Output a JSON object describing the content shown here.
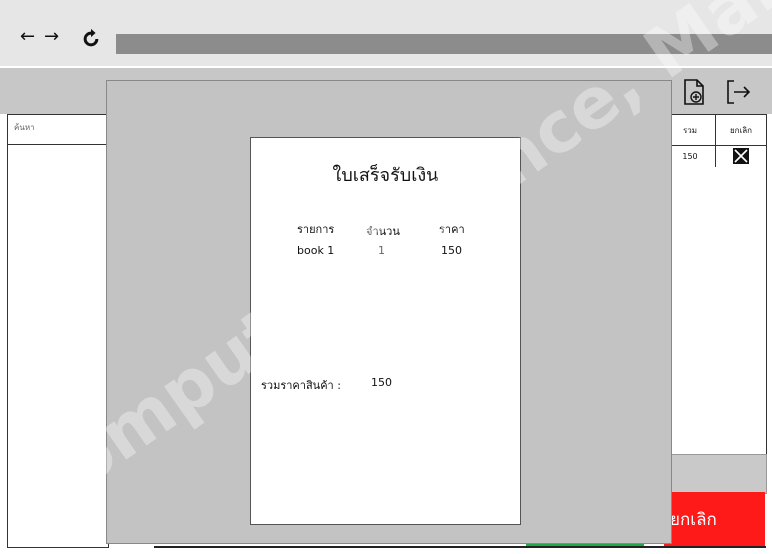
{
  "browser": {
    "back_icon": "arrow-left-icon",
    "forward_icon": "arrow-right-icon",
    "reload_icon": "reload-icon"
  },
  "toolbar": {
    "new_doc_icon": "document-plus-icon",
    "logout_icon": "logout-icon"
  },
  "search": {
    "label": "ค้นหา"
  },
  "table": {
    "headers": [
      "รวม",
      "ยกเลิก"
    ],
    "rows": [
      {
        "total": "150",
        "remove_icon": "remove-x-icon"
      }
    ]
  },
  "cancel_button": {
    "label": "ยกเลิก"
  },
  "receipt": {
    "title": "ใบเสร็จรับเงิน",
    "headers": {
      "item": "รายการ",
      "qty": "จำนวน",
      "price": "ราคา"
    },
    "items": [
      {
        "item": "book 1",
        "qty": "1",
        "price": "150"
      }
    ],
    "total_label": "รวมราคาสินค้า :",
    "total_value": "150"
  },
  "watermark": {
    "text": "Computer Science, Mahasarakham ... of Informatics"
  },
  "colors": {
    "cancel": "#ff1a1a",
    "confirm": "#1ea94a",
    "overlay": "#c3c3c3"
  }
}
